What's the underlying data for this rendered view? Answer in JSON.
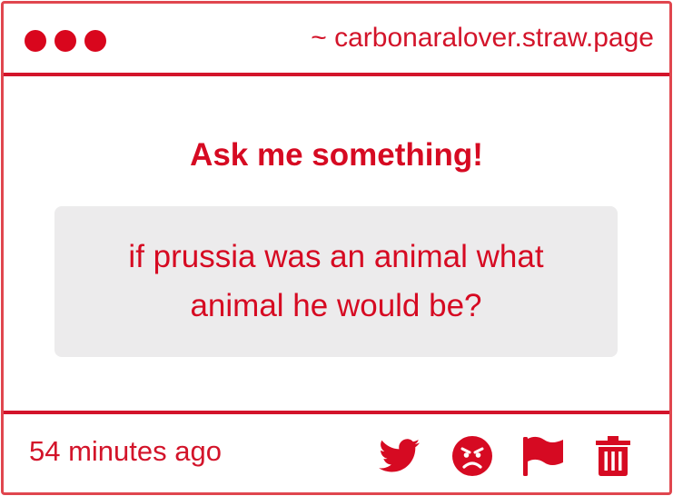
{
  "window": {
    "url": "~ carbonaralover.straw.page",
    "dots": [
      "window-dot-1",
      "window-dot-2",
      "window-dot-3"
    ]
  },
  "main": {
    "heading": "Ask me something!",
    "question": "if prussia was an animal what animal he would be?"
  },
  "footer": {
    "timestamp": "54 minutes ago",
    "actions": [
      {
        "icon": "twitter-icon"
      },
      {
        "icon": "angry-face-icon"
      },
      {
        "icon": "flag-icon"
      },
      {
        "icon": "trash-icon"
      }
    ]
  },
  "colors": {
    "accent": "#d60a22",
    "border": "#e0464e",
    "question_bg": "#ecebec"
  }
}
